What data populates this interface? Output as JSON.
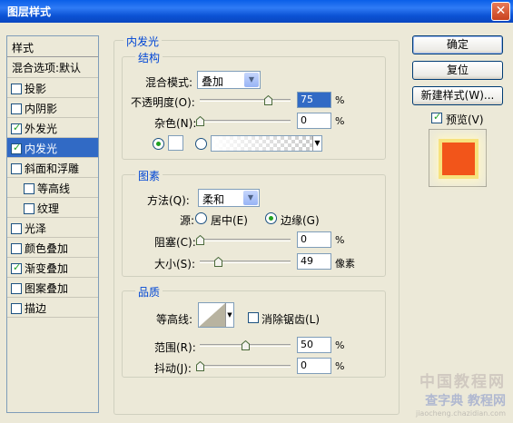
{
  "window": {
    "title": "图层样式",
    "close": "✕"
  },
  "styles_list": {
    "header": "样式",
    "blending": "混合选项:默认",
    "items": [
      {
        "label": "投影",
        "checked": false,
        "indent": false,
        "selected": false
      },
      {
        "label": "内阴影",
        "checked": false,
        "indent": false,
        "selected": false
      },
      {
        "label": "外发光",
        "checked": true,
        "indent": false,
        "selected": false
      },
      {
        "label": "内发光",
        "checked": true,
        "indent": false,
        "selected": true
      },
      {
        "label": "斜面和浮雕",
        "checked": false,
        "indent": false,
        "selected": false
      },
      {
        "label": "等高线",
        "checked": false,
        "indent": true,
        "selected": false
      },
      {
        "label": "纹理",
        "checked": false,
        "indent": true,
        "selected": false
      },
      {
        "label": "光泽",
        "checked": false,
        "indent": false,
        "selected": false
      },
      {
        "label": "颜色叠加",
        "checked": false,
        "indent": false,
        "selected": false
      },
      {
        "label": "渐变叠加",
        "checked": true,
        "indent": false,
        "selected": false
      },
      {
        "label": "图案叠加",
        "checked": false,
        "indent": false,
        "selected": false
      },
      {
        "label": "描边",
        "checked": false,
        "indent": false,
        "selected": false
      }
    ]
  },
  "inner_glow": {
    "legend": "内发光",
    "structure": {
      "legend": "结构",
      "blend_mode_label": "混合模式:",
      "blend_mode_value": "叠加",
      "opacity_label": "不透明度(O):",
      "opacity_value": "75",
      "opacity_level": 0.75,
      "noise_label": "杂色(N):",
      "noise_value": "0",
      "noise_level": 0,
      "percent": "%"
    },
    "elements": {
      "legend": "图素",
      "method_label": "方法(Q):",
      "method_value": "柔和",
      "source_label": "源:",
      "source_center": "居中(E)",
      "source_edge": "边缘(G)",
      "choke_label": "阻塞(C):",
      "choke_value": "0",
      "choke_level": 0,
      "size_label": "大小(S):",
      "size_value": "49",
      "size_level": 0.2,
      "size_unit": "像素",
      "percent": "%"
    },
    "quality": {
      "legend": "品质",
      "contour_label": "等高线:",
      "antialias_label": "消除锯齿(L)",
      "range_label": "范围(R):",
      "range_value": "50",
      "range_level": 0.5,
      "jitter_label": "抖动(J):",
      "jitter_value": "0",
      "jitter_level": 0,
      "percent": "%"
    }
  },
  "buttons": {
    "ok": "确定",
    "reset": "复位",
    "new_style": "新建样式(W)...",
    "preview_label": "预览(V)"
  },
  "watermark": {
    "line1": "中国教程网",
    "line2": "查字典 教程网",
    "line3": "jiaocheng.chazidian.com"
  },
  "colors": {
    "accent": "#0046D5",
    "selection": "#316AC5",
    "preview_fill": "#F2551A",
    "preview_glow": "#F7E27D"
  }
}
